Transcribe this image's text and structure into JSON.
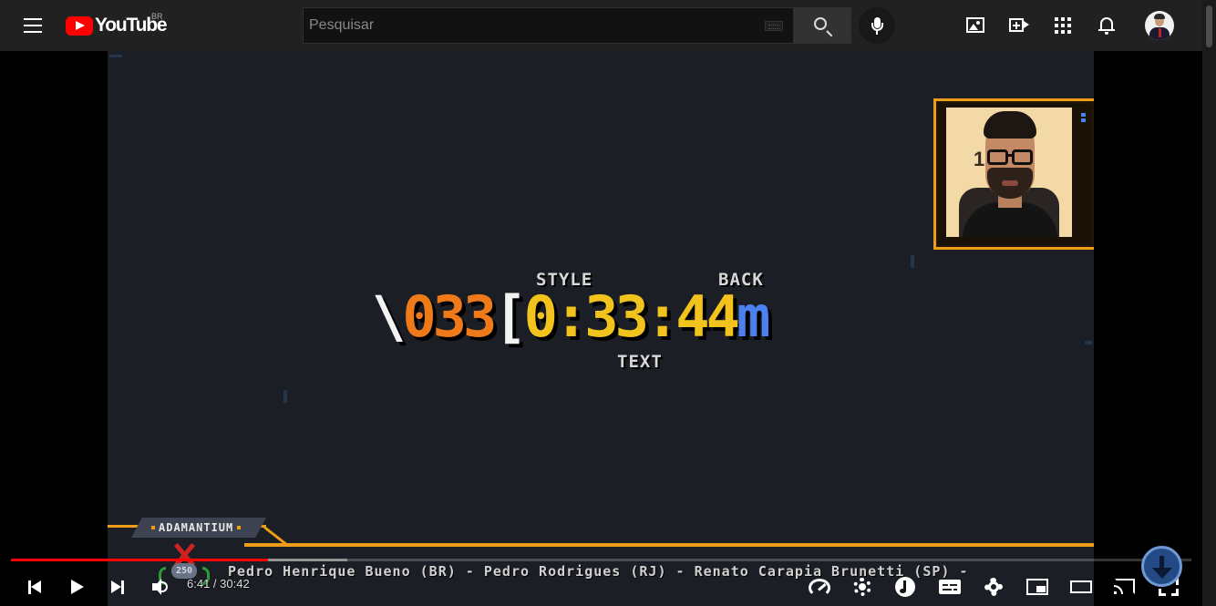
{
  "header": {
    "logo_text": "YouTube",
    "region": "BR",
    "search_placeholder": "Pesquisar",
    "icons": [
      "menu-icon",
      "youtube-logo",
      "keyboard-icon",
      "search-icon",
      "mic-icon",
      "image-icon",
      "create-video-icon",
      "apps-icon",
      "bell-icon",
      "avatar"
    ]
  },
  "video": {
    "overlay": {
      "label_style": "STYLE",
      "label_back": "BACK",
      "label_text": "TEXT",
      "big_a": "\\",
      "big_b": "033",
      "big_c": "[",
      "big_d": "0:33:44",
      "big_e": "m",
      "rank": "ADAMANTIUM",
      "rank_points": "250",
      "webcam_sign": "1  t",
      "credits": "Pedro Henrique Bueno (BR) - Pedro Rodrigues (RJ) - Renato Carapia Brunetti (SP) -"
    },
    "colors": {
      "accent_orange": "#ee9d18",
      "digits_orange": "#ee7a1a",
      "digits_yellow": "#f2c31d",
      "digits_blue": "#4a80f0"
    }
  },
  "player": {
    "time_current": "6:41",
    "time_total": "30:42",
    "time_label": "6:41 / 30:42",
    "progress_played_fraction": 0.2178,
    "progress_loaded_fraction": 0.285,
    "controls": [
      "previous-icon",
      "play-icon",
      "next-icon",
      "volume-icon",
      "speed-icon",
      "autoplay-icon",
      "music-icon",
      "subtitles-icon",
      "settings-icon",
      "miniplayer-icon",
      "theater-icon",
      "cast-icon",
      "fullscreen-icon"
    ]
  }
}
